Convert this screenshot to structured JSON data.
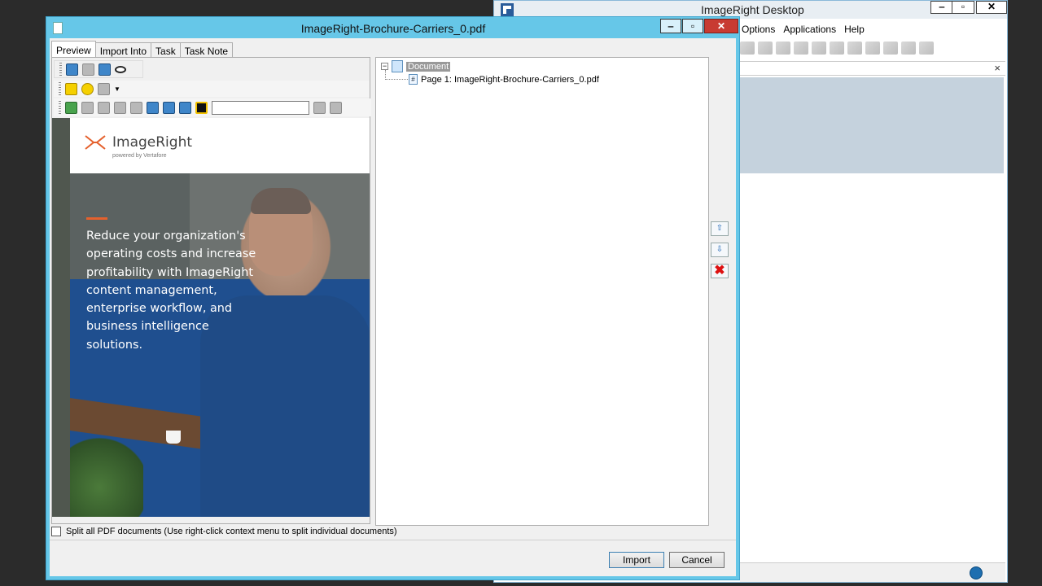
{
  "background_window": {
    "title": "ImageRight Desktop",
    "controls": {
      "minimize": "‒",
      "restore": "▫",
      "close": "✕"
    },
    "menu": [
      "Options",
      "Applications",
      "Help"
    ],
    "panel_close": "×"
  },
  "dialog": {
    "title": "ImageRight-Brochure-Carriers_0.pdf",
    "controls": {
      "minimize": "‒",
      "restore": "▫",
      "close": "✕"
    },
    "tabs": [
      {
        "label": "Preview",
        "active": true
      },
      {
        "label": "Import Into",
        "active": false
      },
      {
        "label": "Task",
        "active": false
      },
      {
        "label": "Task Note",
        "active": false
      }
    ],
    "find_placeholder": ""
  },
  "brochure": {
    "logo_text": "ImageRight",
    "logo_sub": "powered by Vertafore",
    "tagline": "Reduce your organization's operating costs and increase profitability with ImageRight content management, enterprise workflow, and business intelligence solutions.",
    "accent_color": "#e5612d"
  },
  "tree": {
    "root": {
      "toggle": "−",
      "label": "Document"
    },
    "children": [
      {
        "label": "Page 1: ImageRight-Brochure-Carriers_0.pdf",
        "icon": "#"
      }
    ]
  },
  "side_buttons": {
    "up": "⇧",
    "down": "⇩",
    "delete": "✖"
  },
  "footer": {
    "split_label": "Split all PDF documents (Use right-click context menu to split individual documents)",
    "split_checked": false,
    "import_label": "Import",
    "cancel_label": "Cancel"
  }
}
